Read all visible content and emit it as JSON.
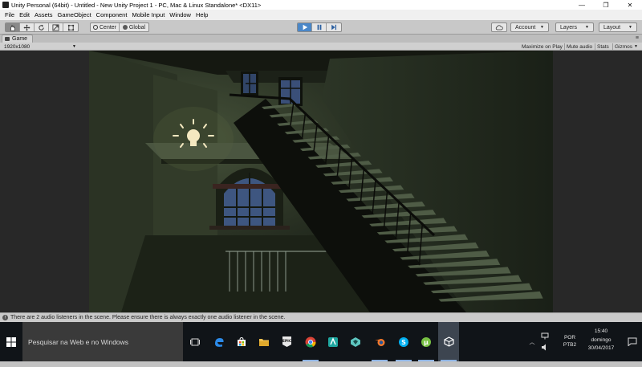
{
  "window": {
    "title": "Unity Personal (64bit) - Untitled - New Unity Project 1 - PC, Mac & Linux Standalone* <DX11>",
    "minimize": "—",
    "maximize": "❐",
    "close": "✕"
  },
  "menu": [
    "File",
    "Edit",
    "Assets",
    "GameObject",
    "Component",
    "Mobile Input",
    "Window",
    "Help"
  ],
  "toolbar": {
    "tools": [
      "hand-icon",
      "move-icon",
      "rotate-icon",
      "scale-icon",
      "rect-icon"
    ],
    "pivot": "Center",
    "space": "Global",
    "play": "play-icon",
    "pause": "pause-icon",
    "step": "step-icon",
    "account": "Account",
    "layers": "Layers",
    "layout": "Layout"
  },
  "game_view": {
    "tab_label": "Game",
    "resolution": "1920x1080",
    "maximize_on_play": "Maximize on Play",
    "mute_audio": "Mute audio",
    "stats": "Stats",
    "gizmos": "Gizmos"
  },
  "status": {
    "message": "There are 2 audio listeners in the scene. Please ensure there is always exactly one audio listener in the scene."
  },
  "taskbar": {
    "search_placeholder": "Pesquisar na Web e no Windows",
    "apps": [
      "task-view-icon",
      "edge-icon",
      "store-icon",
      "epic-games-icon",
      "file-explorer-icon",
      "chrome-icon",
      "app-icon",
      "blender-icon",
      "unity-hub-icon",
      "skype-icon",
      "utorrent-icon",
      "unity-icon"
    ],
    "language_line1": "POR",
    "language_line2": "PTB2",
    "time": "15:40",
    "day": "domingo",
    "date": "30/04/2017"
  },
  "colors": {
    "play_active": "#4a87c8",
    "taskbar": "#101418",
    "scene_wall": "#2e3a26"
  }
}
